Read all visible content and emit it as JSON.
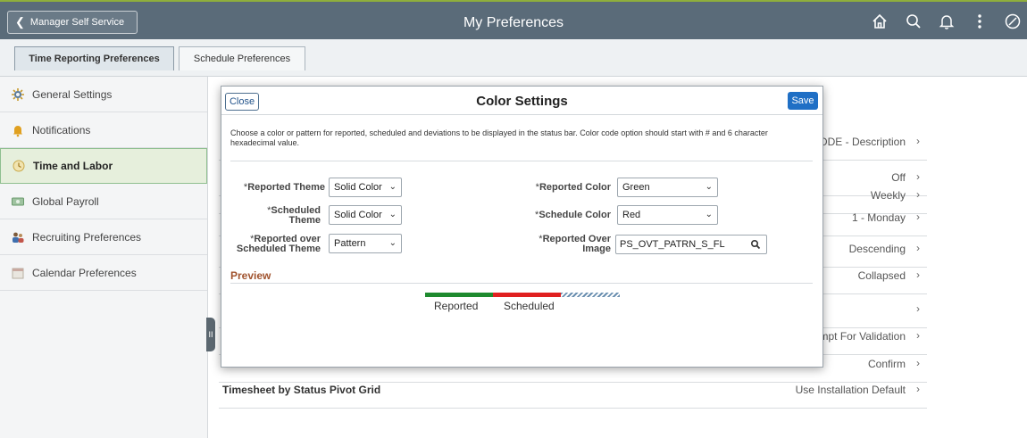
{
  "banner": {
    "back_label": "Manager Self Service",
    "title": "My Preferences",
    "icons": [
      "home-icon",
      "search-icon",
      "bell-icon",
      "more-icon",
      "nav-compass-icon"
    ]
  },
  "tabs": [
    {
      "label": "Time Reporting Preferences",
      "active": true
    },
    {
      "label": "Schedule Preferences",
      "active": false
    }
  ],
  "leftnav": {
    "items": [
      {
        "label": "General Settings",
        "icon": "gear-icon",
        "active": false
      },
      {
        "label": "Notifications",
        "icon": "bell-icon",
        "active": false
      },
      {
        "label": "Time and Labor",
        "icon": "clock-icon",
        "active": true
      },
      {
        "label": "Global Payroll",
        "icon": "payroll-icon",
        "active": false
      },
      {
        "label": "Recruiting Preferences",
        "icon": "recruit-icon",
        "active": false
      },
      {
        "label": "Calendar Preferences",
        "icon": "calendar-icon",
        "active": false
      }
    ]
  },
  "background_list": {
    "rows": [
      {
        "label": "",
        "value": "ODE - Description"
      },
      {
        "label": "",
        "value": "Off"
      },
      {
        "label": "",
        "value": "Weekly"
      },
      {
        "label": "",
        "value": "1 - Monday"
      },
      {
        "label": "",
        "value": "Descending"
      },
      {
        "label": "",
        "value": "Collapsed"
      },
      {
        "label": "",
        "value": ""
      },
      {
        "label": "",
        "value": "mpt For Validation"
      },
      {
        "label": "",
        "value": "Confirm"
      },
      {
        "label": "Timesheet by Status Pivot Grid",
        "value": "Use Installation Default"
      }
    ]
  },
  "modal": {
    "close_label": "Close",
    "title": "Color Settings",
    "save_label": "Save",
    "instructions": "Choose a color or pattern for reported, scheduled and deviations to be displayed in the status bar. Color code option should start with # and 6 character hexadecimal value.",
    "fields": {
      "reported_theme": {
        "label_req": "*",
        "label": "Reported Theme",
        "value": "Solid Color"
      },
      "scheduled_theme": {
        "label_req": "*",
        "label_line1": "Scheduled",
        "label_line2": "Theme",
        "value": "Solid Color"
      },
      "reported_over_scheduled_theme": {
        "label_req": "*",
        "label_line1": "Reported over",
        "label_line2": "Scheduled Theme",
        "value": "Pattern"
      },
      "reported_color": {
        "label_req": "*",
        "label": "Reported Color",
        "value": "Green"
      },
      "schedule_color": {
        "label_req": "*",
        "label": "Schedule Color",
        "value": "Red"
      },
      "reported_over_image": {
        "label_req": "*",
        "label_line1": "Reported Over",
        "label_line2": "Image",
        "value": "PS_OVT_PATRN_S_FL"
      }
    },
    "preview": {
      "title": "Preview",
      "legend": [
        "Reported",
        "Scheduled"
      ],
      "colors": {
        "reported": "#1e8a2e",
        "scheduled": "#e02020",
        "pattern": "#6a8fb0"
      }
    }
  },
  "colors": {
    "banner": "#5a6b79",
    "accent": "#1f6fc5",
    "active_nav": "#e6efdc"
  }
}
